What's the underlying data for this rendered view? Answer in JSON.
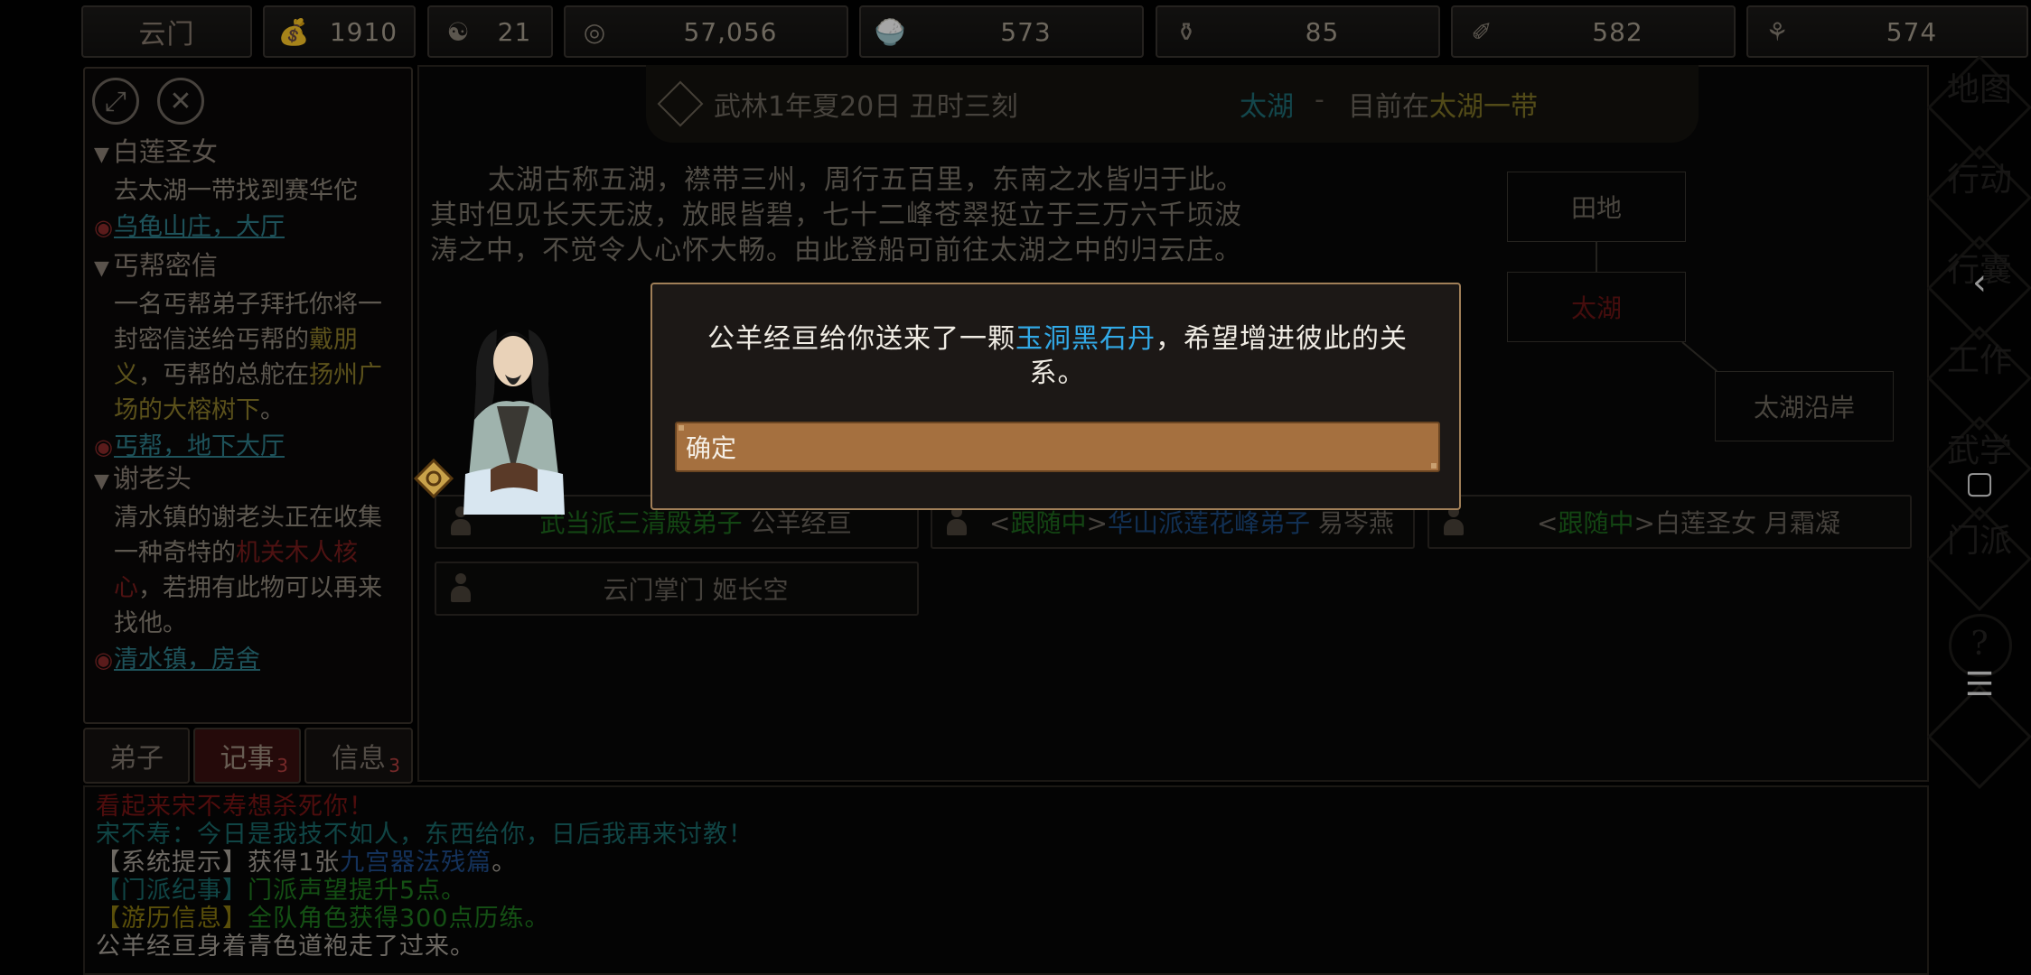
{
  "resources": [
    {
      "icon": "sect-name",
      "value": "云门"
    },
    {
      "icon": "coin-bag-icon",
      "value": "1910"
    },
    {
      "icon": "yin-yang-icon",
      "value": "21"
    },
    {
      "icon": "coin-icon",
      "value": "57,056"
    },
    {
      "icon": "food-bowl-icon",
      "value": "573"
    },
    {
      "icon": "gourd-icon",
      "value": "85"
    },
    {
      "icon": "scroll-icon",
      "value": "582"
    },
    {
      "icon": "beast-icon",
      "value": "574"
    }
  ],
  "quests": [
    {
      "title": "白莲圣女",
      "desc": "去太湖一带找到赛华佗",
      "location": "乌龟山庄，大厅"
    },
    {
      "title": "丐帮密信",
      "desc_parts": [
        "一名丐帮弟子拜托你将一封密信送给丐帮的",
        "戴朋义",
        "，丐帮的总舵在",
        "扬州广场的大榕树下",
        "。"
      ],
      "location": "丐帮，地下大厅"
    },
    {
      "title": "谢老头",
      "desc_parts": [
        "清水镇的谢老头正在收集一种奇特的",
        "机关木人核心",
        "，若拥有此物可以再来找他。"
      ],
      "location": "清水镇，房舍"
    }
  ],
  "tabs": [
    {
      "label": "弟子",
      "badge": ""
    },
    {
      "label": "记事",
      "badge": "3"
    },
    {
      "label": "信息",
      "badge": "3"
    }
  ],
  "header": {
    "date": "武林1年夏20日 丑时三刻",
    "place": "太湖",
    "dash": "-",
    "now_prefix": "目前在",
    "now_place": "太湖一带"
  },
  "description": "太湖古称五湖，襟带三州，周行五百里，东南之水皆归于此。其时但见长天无波，放眼皆碧，七十二峰苍翠挺立于三万六千顷波涛之中，不觉令人心怀大畅。由此登船可前往太湖之中的归云庄。",
  "map": {
    "top": "田地",
    "current": "太湖",
    "right": "太湖沿岸"
  },
  "npcs": [
    {
      "tag": "",
      "faction": "武当派三清殿弟子",
      "name": "公羊经亘"
    },
    {
      "tag": "跟随中",
      "faction": "华山派莲花峰弟子",
      "name": "易岑燕"
    },
    {
      "tag": "跟随中",
      "faction": "白莲圣女",
      "name": "月霜凝"
    },
    {
      "tag": "",
      "faction": "",
      "name": "云门掌门 姬长空"
    }
  ],
  "side_menu": [
    "地图",
    "行动",
    "行囊",
    "工作",
    "武学",
    "门派"
  ],
  "log": [
    {
      "parts": [
        {
          "t": "看起来宋不寿想杀死你！",
          "c": "red"
        }
      ]
    },
    {
      "parts": [
        {
          "t": "宋不寿：今日是我技不如人，东西给你，日后我再来讨教！",
          "c": "teal"
        }
      ]
    },
    {
      "parts": [
        {
          "t": "【系统提示】获得1张",
          "c": "gray"
        },
        {
          "t": "九宫器法残篇",
          "c": "blue"
        },
        {
          "t": "。",
          "c": "gray"
        }
      ]
    },
    {
      "parts": [
        {
          "t": "【门派纪事】",
          "c": "teal"
        },
        {
          "t": "门派声望提升5点。",
          "c": "green"
        }
      ]
    },
    {
      "parts": [
        {
          "t": "【游历信息】",
          "c": "olive"
        },
        {
          "t": "全队角色获得300点历练。",
          "c": "green"
        }
      ]
    },
    {
      "parts": [
        {
          "t": "公羊经亘身着青色道袍走了过来。",
          "c": "gray"
        }
      ]
    }
  ],
  "modal": {
    "pre": "公羊经亘给你送来了一颗",
    "item": "玉洞黑石丹",
    "post": "，希望增进彼此的关系。",
    "ok": "确定"
  },
  "colors": {
    "accent": "#a5703f",
    "item_highlight": "#32a9e6",
    "modal_border": "#a07f58"
  }
}
